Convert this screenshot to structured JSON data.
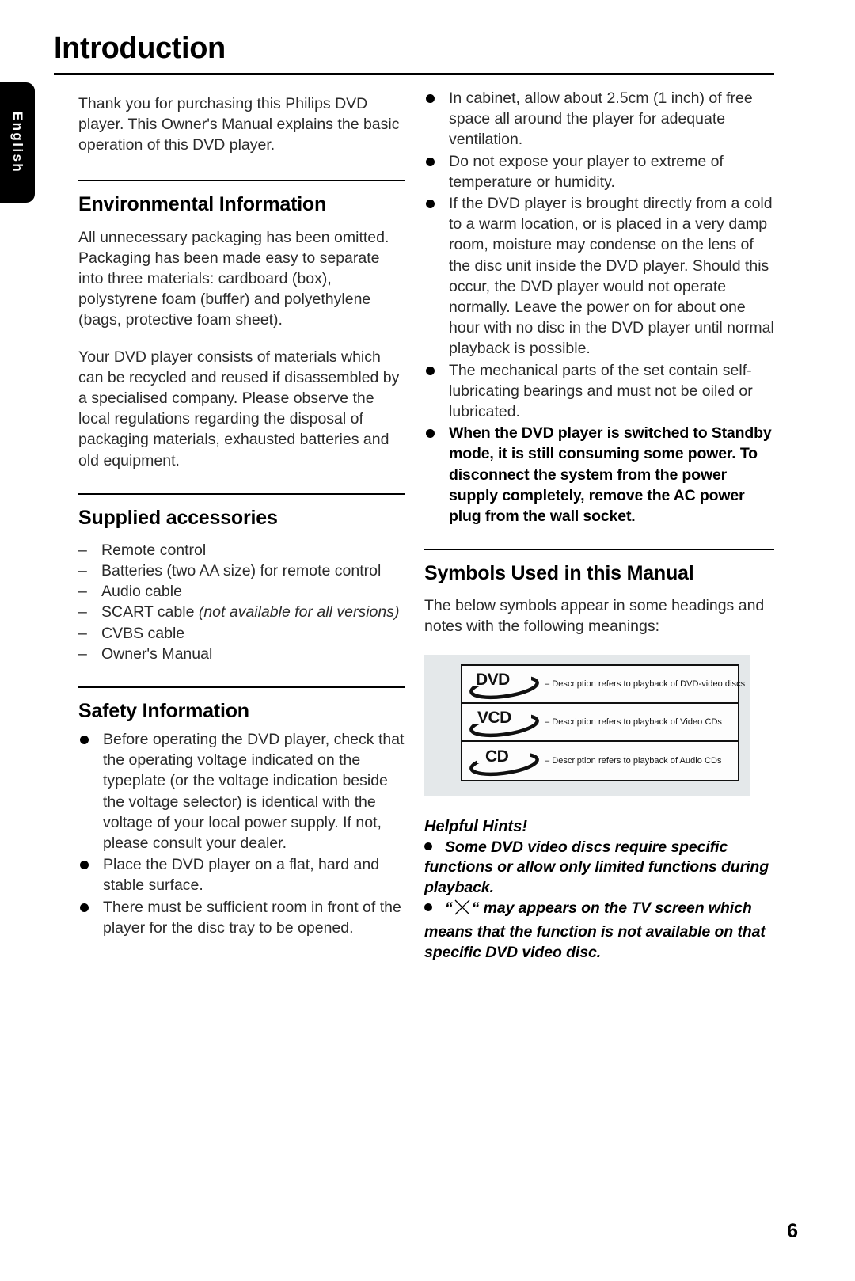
{
  "document": {
    "title": "Introduction",
    "language_tab": "English",
    "page_number": "6"
  },
  "left_column": {
    "intro_paragraph": "Thank you for purchasing this Philips DVD player. This Owner's Manual explains the basic operation of this DVD player.",
    "sections": [
      {
        "heading": "Environmental Information",
        "paragraphs": [
          "All unnecessary packaging has been omitted. Packaging has been made easy to separate into three materials: cardboard (box), polystyrene foam (buffer) and polyethylene (bags, protective foam sheet).",
          "Your DVD player consists of materials which can be recycled and reused if disassembled by a specialised company. Please observe the local regulations regarding the disposal of packaging materials, exhausted batteries and old equipment."
        ]
      },
      {
        "heading": "Supplied accessories",
        "dash_marker": "–",
        "items": [
          {
            "text": "Remote control",
            "italic": ""
          },
          {
            "text": "Batteries (two AA size) for remote control",
            "italic": ""
          },
          {
            "text": "Audio cable",
            "italic": ""
          },
          {
            "text": "SCART cable ",
            "italic": "(not available for all versions)"
          },
          {
            "text": "CVBS cable",
            "italic": ""
          },
          {
            "text": "Owner's Manual",
            "italic": ""
          }
        ]
      },
      {
        "heading": "Safety Information",
        "bullets": [
          "Before operating the DVD player, check that the operating voltage indicated on the typeplate (or the voltage indication beside the voltage selector) is identical with the voltage of your local power supply. If not, please consult your dealer.",
          "Place the DVD player on a flat, hard and stable surface.",
          "There must be sufficient room in front of the player for the disc tray to be opened."
        ]
      }
    ]
  },
  "right_column": {
    "safety_bullets": [
      {
        "text": "In cabinet, allow about 2.5cm (1 inch) of free space all around the player for adequate ventilation.",
        "bold": false
      },
      {
        "text": "Do not expose your player to extreme of temperature or humidity.",
        "bold": false
      },
      {
        "text": "If the DVD player is brought directly from a cold to a warm location, or is placed in a very damp room, moisture may condense on the lens of the disc unit inside the DVD player. Should this occur, the DVD player would not operate normally. Leave the power on for about one hour with no disc in the DVD player until normal playback is possible.",
        "bold": false
      },
      {
        "text": "The mechanical parts of the set contain self-lubricating bearings and must not be oiled or lubricated.",
        "bold": false
      },
      {
        "text": "When the DVD player is switched to Standby mode, it is still consuming some power. To disconnect the system from the power supply completely, remove the AC power plug from the wall socket.",
        "bold": true
      }
    ],
    "symbols_section": {
      "heading": "Symbols Used in this Manual",
      "intro": "The below symbols appear in some headings and notes with the following meanings:",
      "rows": [
        {
          "logo": "DVD",
          "description": "– Description refers to playback of DVD-video discs"
        },
        {
          "logo": "VCD",
          "description": "– Description refers to playback of Video CDs"
        },
        {
          "logo": "CD",
          "description": "– Description refers to playback of Audio CDs"
        }
      ]
    },
    "helpful_hints": {
      "title": "Helpful Hints!",
      "items": [
        {
          "before": "Some DVD video discs require specific functions or allow only limited functions during playback.",
          "has_x_glyph": false,
          "after": ""
        },
        {
          "before": "“",
          "has_x_glyph": true,
          "after": "“ may appears on the TV screen which means that the function is not available on that specific DVD video disc."
        }
      ]
    }
  },
  "colors": {
    "panel_background": "#e4e8ea",
    "text": "#2b2b2b",
    "heading": "#000000",
    "rule": "#000000"
  }
}
